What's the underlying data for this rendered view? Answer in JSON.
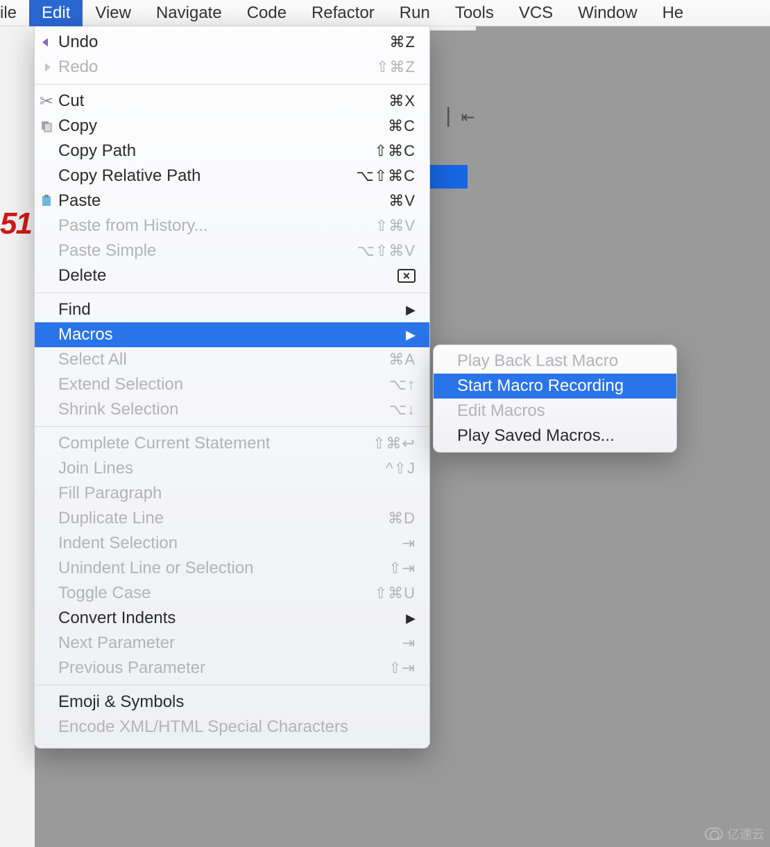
{
  "menubar": {
    "items": [
      {
        "label": "ile"
      },
      {
        "label": "Edit"
      },
      {
        "label": "View"
      },
      {
        "label": "Navigate"
      },
      {
        "label": "Code"
      },
      {
        "label": "Refactor"
      },
      {
        "label": "Run"
      },
      {
        "label": "Tools"
      },
      {
        "label": "VCS"
      },
      {
        "label": "Window"
      },
      {
        "label": "He"
      }
    ],
    "active_index": 1
  },
  "gutter": {
    "red_text": "51"
  },
  "edit_menu": {
    "groups": [
      [
        {
          "label": "Undo",
          "shortcut": "⌘Z",
          "icon": "undo",
          "disabled": false
        },
        {
          "label": "Redo",
          "shortcut": "⇧⌘Z",
          "icon": "redo",
          "disabled": true
        }
      ],
      [
        {
          "label": "Cut",
          "shortcut": "⌘X",
          "icon": "cut",
          "disabled": false
        },
        {
          "label": "Copy",
          "shortcut": "⌘C",
          "icon": "copy",
          "disabled": false
        },
        {
          "label": "Copy Path",
          "shortcut": "⇧⌘C",
          "disabled": false
        },
        {
          "label": "Copy Relative Path",
          "shortcut": "⌥⇧⌘C",
          "disabled": false
        },
        {
          "label": "Paste",
          "shortcut": "⌘V",
          "icon": "paste",
          "disabled": false
        },
        {
          "label": "Paste from History...",
          "shortcut": "⇧⌘V",
          "disabled": true
        },
        {
          "label": "Paste Simple",
          "shortcut": "⌥⇧⌘V",
          "disabled": true
        },
        {
          "label": "Delete",
          "shortcut_badge": "delete",
          "disabled": false
        }
      ],
      [
        {
          "label": "Find",
          "submenu": true,
          "disabled": false
        },
        {
          "label": "Macros",
          "submenu": true,
          "selected": true,
          "disabled": false
        },
        {
          "label": "Select All",
          "shortcut": "⌘A",
          "disabled": true
        },
        {
          "label": "Extend Selection",
          "shortcut": "⌥↑",
          "disabled": true
        },
        {
          "label": "Shrink Selection",
          "shortcut": "⌥↓",
          "disabled": true
        }
      ],
      [
        {
          "label": "Complete Current Statement",
          "shortcut": "⇧⌘↩",
          "disabled": true
        },
        {
          "label": "Join Lines",
          "shortcut": "^⇧J",
          "disabled": true
        },
        {
          "label": "Fill Paragraph",
          "disabled": true
        },
        {
          "label": "Duplicate Line",
          "shortcut": "⌘D",
          "disabled": true
        },
        {
          "label": "Indent Selection",
          "shortcut": "⇥",
          "disabled": true
        },
        {
          "label": "Unindent Line or Selection",
          "shortcut": "⇧⇥",
          "disabled": true
        },
        {
          "label": "Toggle Case",
          "shortcut": "⇧⌘U",
          "disabled": true
        },
        {
          "label": "Convert Indents",
          "submenu": true,
          "disabled": false
        },
        {
          "label": "Next Parameter",
          "shortcut": "⇥",
          "disabled": true
        },
        {
          "label": "Previous Parameter",
          "shortcut": "⇧⇥",
          "disabled": true
        }
      ],
      [
        {
          "label": "Emoji & Symbols",
          "disabled": false
        },
        {
          "label": "Encode XML/HTML Special Characters",
          "disabled": true
        }
      ]
    ]
  },
  "macros_submenu": {
    "items": [
      {
        "label": "Play Back Last Macro",
        "disabled": true
      },
      {
        "label": "Start Macro Recording",
        "selected": true,
        "disabled": false
      },
      {
        "label": "Edit Macros",
        "disabled": true
      },
      {
        "label": "Play Saved Macros...",
        "disabled": false
      }
    ]
  },
  "watermark": {
    "text": "亿速云"
  }
}
